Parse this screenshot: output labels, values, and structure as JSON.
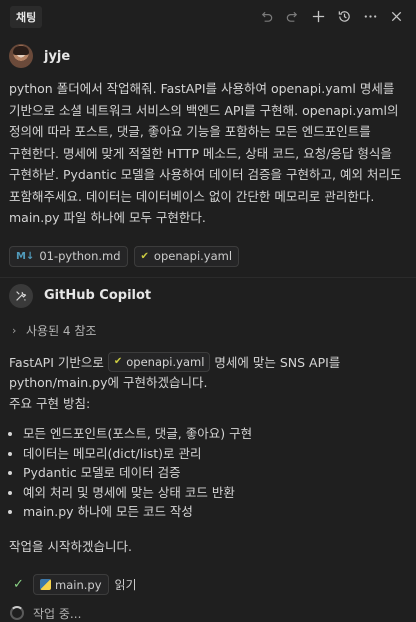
{
  "header": {
    "tab_title": "채팅",
    "icons": [
      "undo-icon",
      "redo-icon",
      "plus-icon",
      "history-icon",
      "more-icon",
      "close-icon"
    ]
  },
  "user": {
    "name": "jyje",
    "message": "python 폴더에서 작업해줘. FastAPI를 사용하여 openapi.yaml 명세를 기반으로 소셜 네트워크 서비스의 백엔드 API를 구현해. openapi.yaml의 정의에 따라 포스트, 댓글, 좋아요 기능을 포함하는 모든 엔드포인트를 구현한다. 명세에 맞게 적절한 HTTP 메소드, 상태 코드, 요청/응답 형식을 구현하낟. Pydantic 모델을 사용하여 데이터 검증을 구현하고, 예외 처리도 포함해주세요. 데이터는 데이터베이스 없이 간단한 메모리로 관리한다. main.py 파일 하나에 모두 구현한다.",
    "attachments": [
      {
        "icon": "M↓",
        "label": "01-python.md"
      },
      {
        "icon": "✔",
        "label": "openapi.yaml"
      }
    ]
  },
  "assistant": {
    "name": "GitHub Copilot",
    "refs_label": "사용된 4 참조",
    "intro_before": "FastAPI 기반으로",
    "intro_chip": "openapi.yaml",
    "intro_after": "명세에 맞는 SNS API를 python/main.py에 구현하겠습니다.",
    "section_title": "주요 구현 방침:",
    "points": [
      "모든 엔드포인트(포스트, 댓글, 좋아요) 구현",
      "데이터는 메모리(dict/list)로 관리",
      "Pydantic 모델로 데이터 검증",
      "예외 처리 및 명세에 맞는 상태 코드 반환",
      "main.py 하나에 모든 코드 작성"
    ],
    "start_text": "작업을 시작하겠습니다.",
    "step_file": "main.py",
    "step_action": "읽기",
    "working_text": "작업 중..."
  }
}
